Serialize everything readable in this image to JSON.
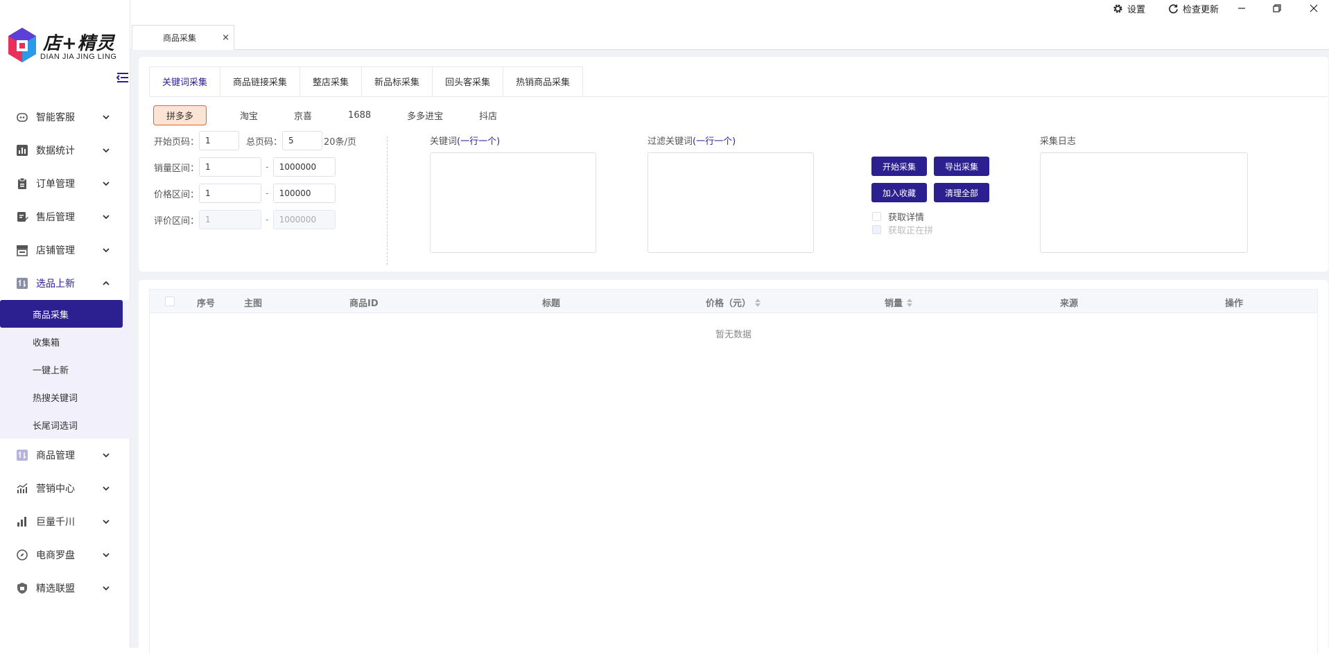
{
  "app": {
    "logo_name": "店+精灵",
    "logo_sub": "DIAN JIA JING LING"
  },
  "topbar": {
    "settings_label": "设置",
    "update_label": "检查更新"
  },
  "sidebar": {
    "items": [
      {
        "label": "智能客服",
        "icon": "robot-icon"
      },
      {
        "label": "数据统计",
        "icon": "bar-chart-icon"
      },
      {
        "label": "订单管理",
        "icon": "clipboard-icon"
      },
      {
        "label": "售后管理",
        "icon": "edit-doc-icon"
      },
      {
        "label": "店铺管理",
        "icon": "store-icon"
      },
      {
        "label": "选品上新",
        "icon": "sort-box-icon"
      },
      {
        "label": "商品管理",
        "icon": "sort-box-icon"
      },
      {
        "label": "营销中心",
        "icon": "growth-chart-icon"
      },
      {
        "label": "巨量千川",
        "icon": "signal-bars-icon"
      },
      {
        "label": "电商罗盘",
        "icon": "compass-icon"
      },
      {
        "label": "精选联盟",
        "icon": "shield-icon"
      }
    ],
    "subitems": [
      "商品采集",
      "收集箱",
      "一键上新",
      "热搜关键词",
      "长尾词选词"
    ]
  },
  "page_tab": {
    "label": "商品采集",
    "close": "×"
  },
  "collect_tabs": [
    "关键词采集",
    "商品链接采集",
    "整店采集",
    "新品标采集",
    "回头客采集",
    "热销商品采集"
  ],
  "platforms": [
    "拼多多",
    "淘宝",
    "京喜",
    "1688",
    "多多进宝",
    "抖店"
  ],
  "form": {
    "start_page_label": "开始页码：",
    "start_page": "1",
    "total_page_label": "总页码：",
    "total_page": "5",
    "per_page": "20条/页",
    "sales_label": "销量区间：",
    "sales_min": "1",
    "sales_max": "1000000",
    "price_label": "价格区间：",
    "price_min": "1",
    "price_max": "100000",
    "review_label": "评价区间：",
    "review_min": "1",
    "review_max": "1000000",
    "dash": "-"
  },
  "keywords": {
    "label": "关键词",
    "hint": "(一行一个)"
  },
  "filter_keywords": {
    "label": "过滤关键词",
    "hint": "(一行一个)"
  },
  "log": {
    "label": "采集日志"
  },
  "actions": {
    "start": "开始采集",
    "export": "导出采集",
    "favorite": "加入收藏",
    "clear": "清理全部",
    "detail_label": "获取详情",
    "grouping_label": "获取正在拼"
  },
  "table": {
    "columns": [
      "序号",
      "主图",
      "商品ID",
      "标题",
      "价格（元）",
      "销量",
      "来源",
      "操作"
    ],
    "empty_text": "暂无数据"
  }
}
